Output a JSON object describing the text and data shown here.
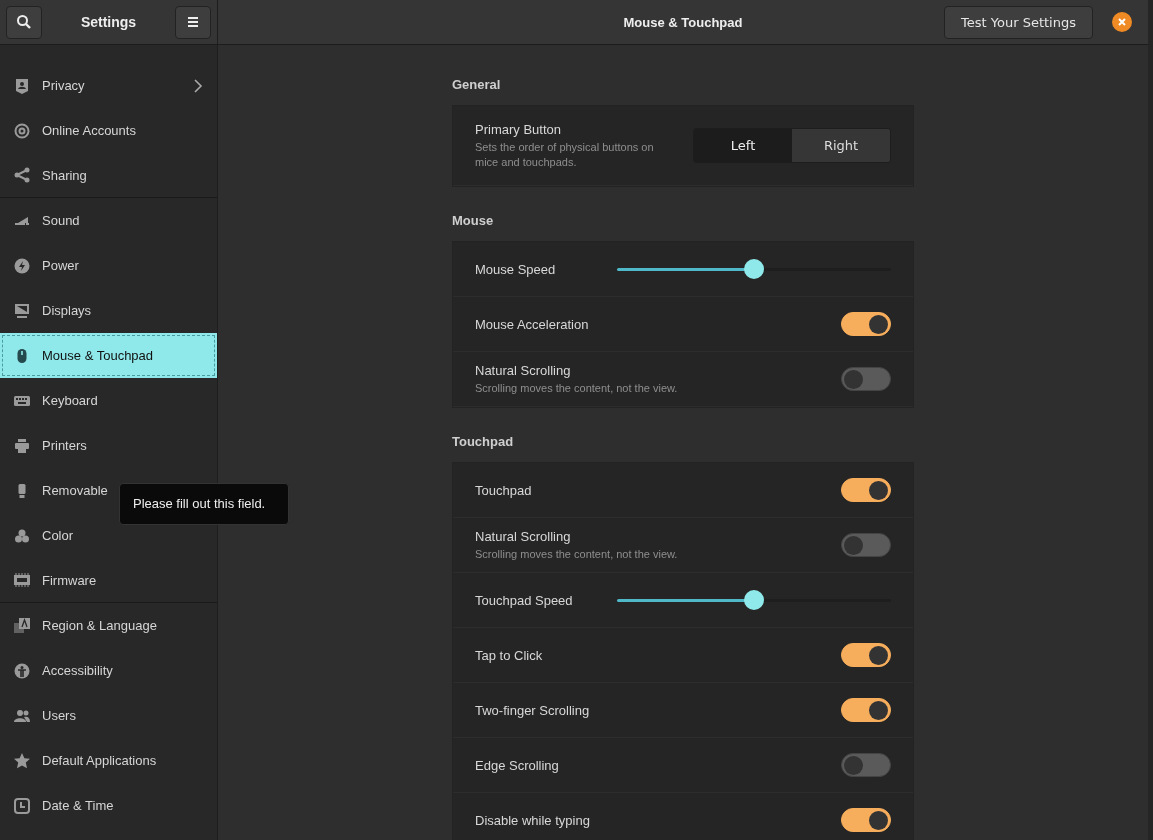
{
  "sidebar": {
    "title": "Settings",
    "items": [
      {
        "label": "Privacy",
        "selected": false,
        "has_submenu": true
      },
      {
        "label": "Online Accounts",
        "selected": false
      },
      {
        "label": "Sharing",
        "selected": false,
        "separator_after": true
      },
      {
        "label": "Sound",
        "selected": false
      },
      {
        "label": "Power",
        "selected": false
      },
      {
        "label": "Displays",
        "selected": false
      },
      {
        "label": "Mouse & Touchpad",
        "selected": true
      },
      {
        "label": "Keyboard",
        "selected": false
      },
      {
        "label": "Printers",
        "selected": false
      },
      {
        "label": "Removable",
        "selected": false
      },
      {
        "label": "Color",
        "selected": false
      },
      {
        "label": "Firmware",
        "selected": false,
        "separator_after": true
      },
      {
        "label": "Region & Language",
        "selected": false
      },
      {
        "label": "Accessibility",
        "selected": false
      },
      {
        "label": "Users",
        "selected": false
      },
      {
        "label": "Default Applications",
        "selected": false
      },
      {
        "label": "Date & Time",
        "selected": false
      }
    ]
  },
  "header": {
    "title": "Mouse & Touchpad",
    "test_button": "Test Your Settings"
  },
  "tooltip": "Please fill out this field.",
  "sections": [
    {
      "title": "General",
      "rows": [
        {
          "kind": "buttons",
          "label": "Primary Button",
          "description": "Sets the order of physical buttons on mice and touchpads.",
          "options": [
            {
              "label": "Left",
              "selected": true
            },
            {
              "label": "Right",
              "selected": false
            }
          ]
        }
      ]
    },
    {
      "title": "Mouse",
      "rows": [
        {
          "kind": "slider",
          "label": "Mouse Speed",
          "level": 0.5
        },
        {
          "kind": "switch",
          "label": "Mouse Acceleration",
          "on": true
        },
        {
          "kind": "switch",
          "label": "Natural Scrolling",
          "description": "Scrolling moves the content, not the view.",
          "on": false
        }
      ]
    },
    {
      "title": "Touchpad",
      "rows": [
        {
          "kind": "switch",
          "label": "Touchpad",
          "on": true
        },
        {
          "kind": "switch",
          "label": "Natural Scrolling",
          "description": "Scrolling moves the content, not the view.",
          "on": false
        },
        {
          "kind": "slider",
          "label": "Touchpad Speed",
          "level": 0.5
        },
        {
          "kind": "switch",
          "label": "Tap to Click",
          "on": true
        },
        {
          "kind": "switch",
          "label": "Two-finger Scrolling",
          "on": true
        },
        {
          "kind": "switch",
          "label": "Edge Scrolling",
          "on": false
        },
        {
          "kind": "switch",
          "label": "Disable while typing",
          "on": true
        }
      ]
    }
  ]
}
